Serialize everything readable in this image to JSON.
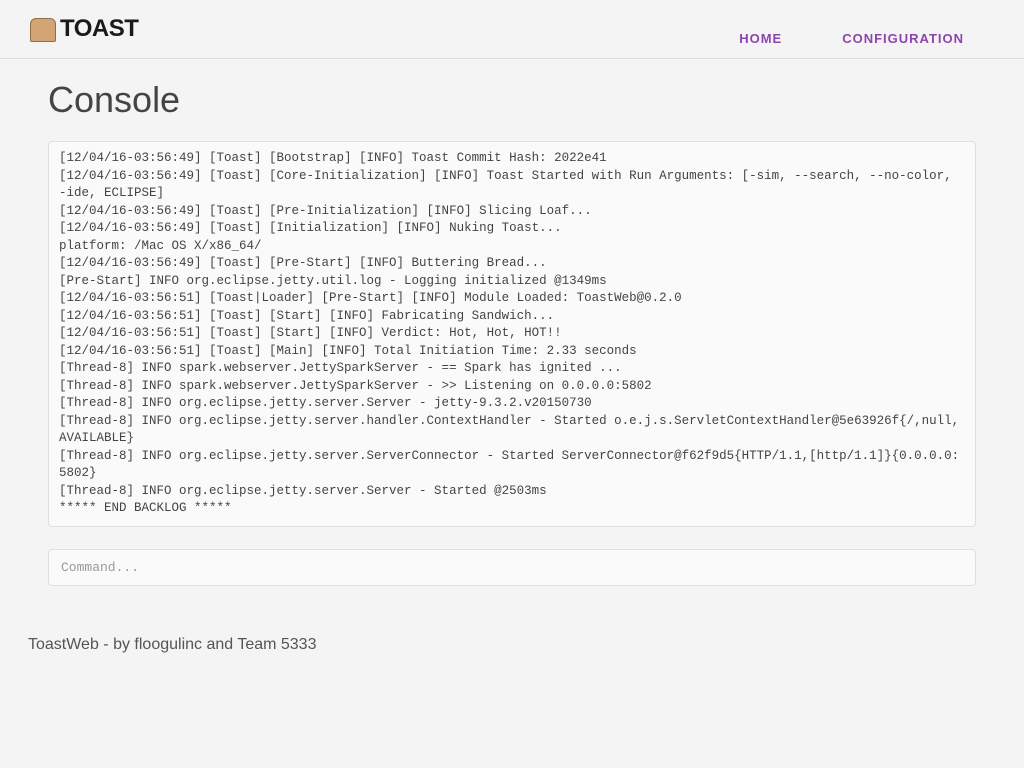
{
  "header": {
    "brand": "TOAST",
    "nav": {
      "home": "HOME",
      "configuration": "CONFIGURATION"
    }
  },
  "page": {
    "title": "Console"
  },
  "console": {
    "lines": "[12/04/16-03:56:49] [Toast] [Bootstrap] [INFO] Toast Commit Hash: 2022e41\n[12/04/16-03:56:49] [Toast] [Core-Initialization] [INFO] Toast Started with Run Arguments: [-sim, --search, --no-color, -ide, ECLIPSE]\n[12/04/16-03:56:49] [Toast] [Pre-Initialization] [INFO] Slicing Loaf...\n[12/04/16-03:56:49] [Toast] [Initialization] [INFO] Nuking Toast...\nplatform: /Mac OS X/x86_64/\n[12/04/16-03:56:49] [Toast] [Pre-Start] [INFO] Buttering Bread...\n[Pre-Start] INFO org.eclipse.jetty.util.log - Logging initialized @1349ms\n[12/04/16-03:56:51] [Toast|Loader] [Pre-Start] [INFO] Module Loaded: ToastWeb@0.2.0\n[12/04/16-03:56:51] [Toast] [Start] [INFO] Fabricating Sandwich...\n[12/04/16-03:56:51] [Toast] [Start] [INFO] Verdict: Hot, Hot, HOT!!\n[12/04/16-03:56:51] [Toast] [Main] [INFO] Total Initiation Time: 2.33 seconds\n[Thread-8] INFO spark.webserver.JettySparkServer - == Spark has ignited ...\n[Thread-8] INFO spark.webserver.JettySparkServer - >> Listening on 0.0.0.0:5802\n[Thread-8] INFO org.eclipse.jetty.server.Server - jetty-9.3.2.v20150730\n[Thread-8] INFO org.eclipse.jetty.server.handler.ContextHandler - Started o.e.j.s.ServletContextHandler@5e63926f{/,null,AVAILABLE}\n[Thread-8] INFO org.eclipse.jetty.server.ServerConnector - Started ServerConnector@f62f9d5{HTTP/1.1,[http/1.1]}{0.0.0.0:5802}\n[Thread-8] INFO org.eclipse.jetty.server.Server - Started @2503ms\n***** END BACKLOG *****"
  },
  "command": {
    "placeholder": "Command...",
    "value": ""
  },
  "footer": {
    "text": "ToastWeb - by floogulinc and Team 5333"
  }
}
